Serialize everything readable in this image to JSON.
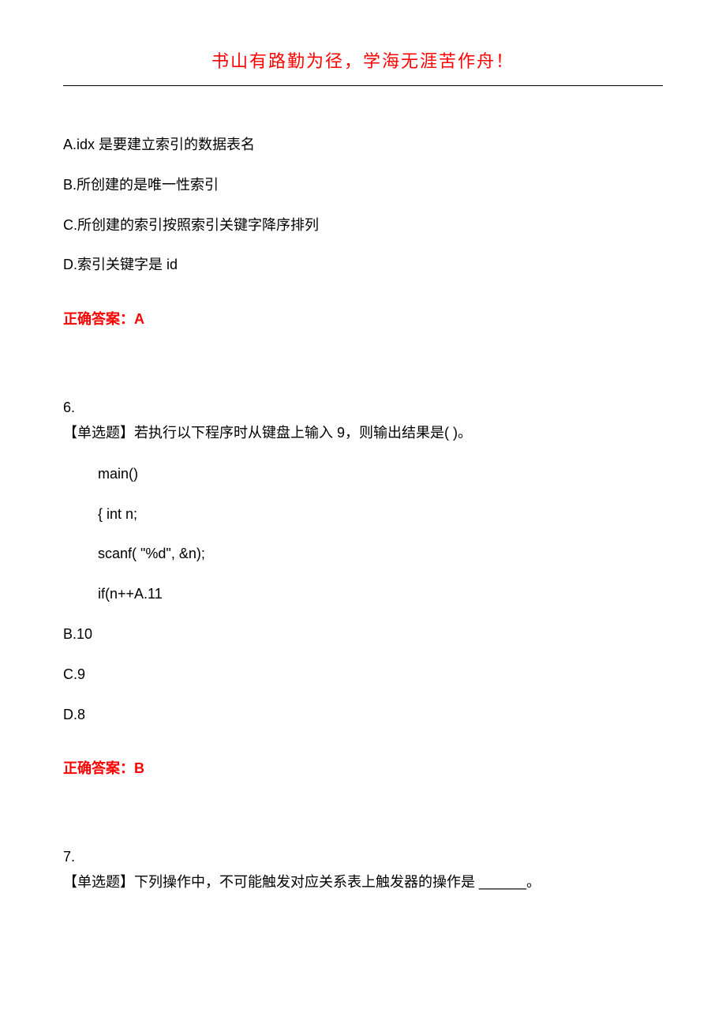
{
  "header": "书山有路勤为径，学海无涯苦作舟！",
  "q5": {
    "optA": "A.idx 是要建立索引的数据表名",
    "optB": "B.所创建的是唯一性索引",
    "optC": "C.所创建的索引按照索引关键字降序排列",
    "optD": "D.索引关键字是 id",
    "answer": "正确答案：A"
  },
  "q6": {
    "num": "6.",
    "stem": "【单选题】若执行以下程序时从键盘上输入 9，则输出结果是( )。",
    "code1": "main()",
    "code2": "{ int n;",
    "code3": "scanf( \"%d\",    &n);",
    "code4": "if(n++A.11",
    "optB": "B.10",
    "optC": "C.9",
    "optD": "D.8",
    "answer": "正确答案：B"
  },
  "q7": {
    "num": "7.",
    "stem": "【单选题】下列操作中，不可能触发对应关系表上触发器的操作是 ______。"
  }
}
